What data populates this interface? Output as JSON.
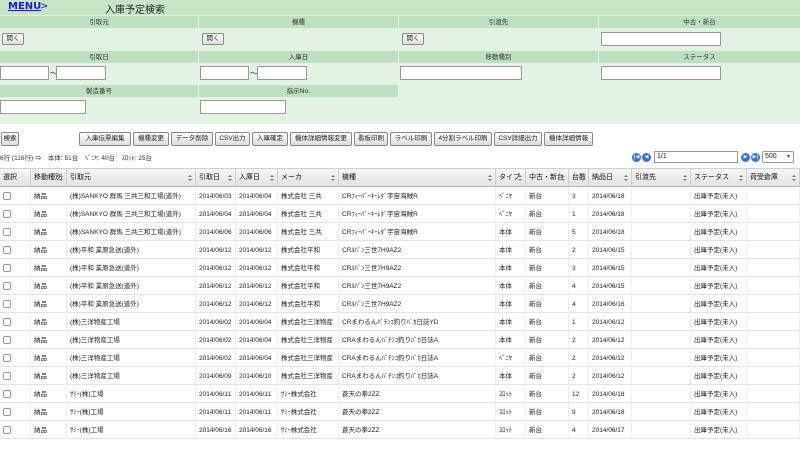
{
  "header": {
    "menu": "MENU",
    "arrow": ">",
    "title": "入庫予定検索"
  },
  "search": {
    "row1": {
      "from_label": "引取元",
      "model_label": "機種",
      "to_label": "引渡先",
      "used_new_label": "中古・新台",
      "open": "開く"
    },
    "row2": {
      "pickup_label": "引取日",
      "arrival_label": "入庫日",
      "move_type_label": "移動種別",
      "status_label": "ステータス",
      "tilde": "～"
    },
    "row3": {
      "serial_label": "製造番号",
      "order_no_label": "指示No."
    }
  },
  "toolbar": {
    "search": "検索",
    "buttons": [
      "入庫伝票編集",
      "機種変更",
      "データ削除",
      "CSV出力",
      "入庫確定",
      "機体詳細情報変更",
      "看板印刷",
      "ラベル印刷",
      "4分割ラベル印刷",
      "CSV詳細出力",
      "機体詳細情報"
    ]
  },
  "summary": {
    "text": "6行 (116行) ⇒　本体: 51台　ﾍﾞﾆﾔ: 40台　ｽﾛｯﾄ: 25台"
  },
  "pager": {
    "first": "|◀",
    "prev": "◀",
    "page": "1/1",
    "next": "▶",
    "last": "▶|",
    "per_page": "500"
  },
  "grid": {
    "columns": [
      "選択",
      "移動種別",
      "引取元",
      "引取日",
      "入庫日",
      "メーカ",
      "機種",
      "タイプ",
      "中古・新台",
      "台数",
      "納品日",
      "引渡先",
      "ステータス",
      "荷受倉庫"
    ],
    "rows": [
      [
        "納品",
        "(株)SANKYO 群馬 三共三和工場(道外)",
        "2014/06/03",
        "2014/06/04",
        "株式会社 三共",
        "CRﾌｨｰﾊﾞｰｷｰﾚﾀﾞ宇宙海賊R",
        "ﾍﾞﾆﾔ",
        "新台",
        "3",
        "2014/06/18",
        "",
        "出庫予定(未入)",
        ""
      ],
      [
        "納品",
        "(株)SANKYO 群馬 三共三和工場(道外)",
        "2014/06/04",
        "2014/06/04",
        "株式会社 三共",
        "CRﾌｨｰﾊﾞｰｷｰﾚﾀﾞ宇宙海賊R",
        "ﾍﾞﾆﾔ",
        "新台",
        "1",
        "2014/06/18",
        "",
        "出庫予定(未入)",
        ""
      ],
      [
        "納品",
        "(株)SANKYO 群馬 三共三和工場(道外)",
        "2014/06/06",
        "2014/06/06",
        "株式会社 三共",
        "CRﾌｨｰﾊﾞｰｷｰﾚﾀﾞ宇宙海賊R",
        "本体",
        "新台",
        "5",
        "2014/06/18",
        "",
        "出庫予定(未入)",
        ""
      ],
      [
        "納品",
        "(株)平和 業原急送(道外)",
        "2014/06/12",
        "2014/06/12",
        "株式会社平和",
        "CRﾙﾊﾟﾝ三世7H9AZ2",
        "本体",
        "新台",
        "2",
        "2014/06/15",
        "",
        "出庫予定(未入)",
        ""
      ],
      [
        "納品",
        "(株)平和 業原急送(道外)",
        "2014/06/12",
        "2014/06/12",
        "株式会社平和",
        "CRﾙﾊﾟﾝ三世7H9AZ2",
        "本体",
        "新台",
        "3",
        "2014/06/15",
        "",
        "出庫予定(未入)",
        ""
      ],
      [
        "納品",
        "(株)平和 業原急送(道外)",
        "2014/06/12",
        "2014/06/12",
        "株式会社平和",
        "CRﾙﾊﾟﾝ三世7H9AZ2",
        "本体",
        "新台",
        "4",
        "2014/06/15",
        "",
        "出庫予定(未入)",
        ""
      ],
      [
        "納品",
        "(株)平和 業原急送(道外)",
        "2014/06/12",
        "2014/06/12",
        "株式会社平和",
        "CRﾙﾊﾟﾝ三世7H9AZ2",
        "本体",
        "新台",
        "4",
        "2014/06/16",
        "",
        "出庫予定(未入)",
        ""
      ],
      [
        "納品",
        "(株)三洋物産工場",
        "2014/06/02",
        "2014/06/04",
        "株式会社三洋物産",
        "CRまわるんﾊﾟﾁﾝｺ釣りﾊﾞｶ日誌YD",
        "本体",
        "新台",
        "1",
        "2014/06/12",
        "",
        "出庫予定(未入)",
        ""
      ],
      [
        "納品",
        "(株)三洋物産工場",
        "2014/06/02",
        "2014/06/04",
        "株式会社三洋物産",
        "CRAまわるんﾊﾟﾁﾝｺ釣りﾊﾞｶ日誌A",
        "本体",
        "新台",
        "2",
        "2014/06/12",
        "",
        "出庫予定(未入)",
        ""
      ],
      [
        "納品",
        "(株)三洋物産工場",
        "2014/06/02",
        "2014/06/04",
        "株式会社三洋物産",
        "CRAまわるんﾊﾟﾁﾝｺ釣りﾊﾞｶ日誌A",
        "ﾍﾞﾆﾔ",
        "新台",
        "2",
        "2014/06/12",
        "",
        "出庫予定(未入)",
        ""
      ],
      [
        "納品",
        "(株)三洋物産工場",
        "2014/06/09",
        "2014/06/10",
        "株式会社三洋物産",
        "CRAまわるんﾊﾟﾁﾝｺ釣りﾊﾞｶ日誌A",
        "本体",
        "新台",
        "2",
        "2014/06/12",
        "",
        "出庫予定(未入)",
        ""
      ],
      [
        "納品",
        "ｻﾐｰ(株)工場",
        "2014/06/11",
        "2014/06/11",
        "ｻﾐｰ株式会社",
        "蒼天の拳2ZZ",
        "ｽﾛｯﾄ",
        "新台",
        "12",
        "2014/06/18",
        "",
        "出庫予定(未入)",
        ""
      ],
      [
        "納品",
        "ｻﾐｰ(株)工場",
        "2014/06/11",
        "2014/06/11",
        "ｻﾐｰ株式会社",
        "蒼天の拳2ZZ",
        "ｽﾛｯﾄ",
        "新台",
        "9",
        "2014/06/18",
        "",
        "出庫予定(未入)",
        ""
      ],
      [
        "納品",
        "ｻﾐｰ(株)工場",
        "2014/06/16",
        "2014/06/16",
        "ｻﾐｰ株式会社",
        "蒼天の拳2ZZ",
        "ｽﾛｯﾄ",
        "新台",
        "4",
        "2014/06/17",
        "",
        "出庫予定(未入)",
        ""
      ]
    ]
  }
}
